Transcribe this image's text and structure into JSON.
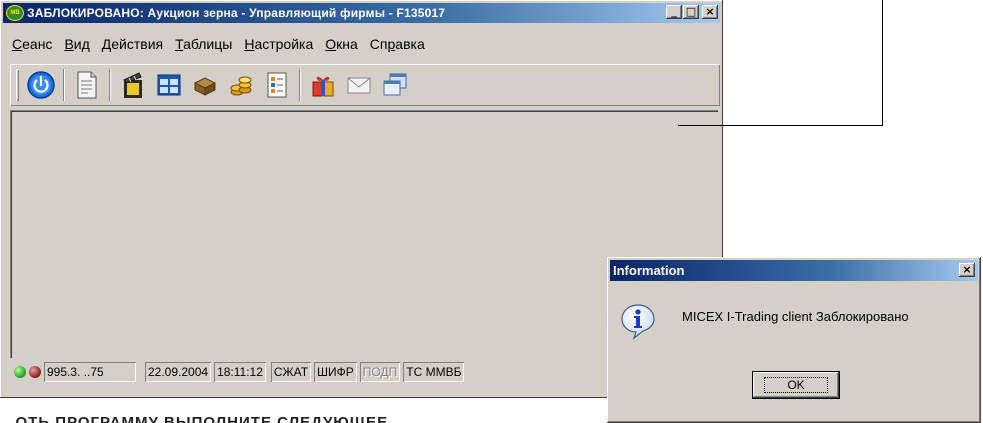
{
  "window": {
    "title": "ЗАБЛОКИРОВАНО: Аукцион зерна - Управляющий фирмы - F135017",
    "app_icon_text": "MB",
    "buttons": {
      "minimize": "_",
      "maximize": "□",
      "close": "×"
    }
  },
  "menu": [
    {
      "hot": "С",
      "rest": "еанс"
    },
    {
      "hot": "В",
      "rest": "ид"
    },
    {
      "hot": "Д",
      "rest": "ействия"
    },
    {
      "hot": "Т",
      "rest": "аблицы"
    },
    {
      "hot": "Н",
      "rest": "астройка"
    },
    {
      "hot": "О",
      "rest": "кна"
    },
    {
      "hot": "",
      "rest": "Сп",
      "hot2": "р",
      "rest2": "авка"
    }
  ],
  "toolbar": {
    "icons": [
      "power-icon",
      "document-icon",
      "clapperboard-icon",
      "table-icon",
      "box-icon",
      "coins-icon",
      "report-icon",
      "gift-icon",
      "envelope-icon",
      "window-icon"
    ]
  },
  "statusbar": {
    "address": "995.3. ..75",
    "date": "22.09.2004",
    "time": "18:11:12",
    "compress": "СЖАТ",
    "cipher": "ШИФР",
    "sign": "ПОДП",
    "exchange": "ТС ММВБ"
  },
  "dialog": {
    "title": "Information",
    "close": "×",
    "message": "MICEX I-Trading client Заблокировано",
    "ok_label": "OK"
  },
  "background_text": "...ОТЬ ПРОГРАММУ ВЫПОЛНИТЕ СЛЕДУЮЩЕЕ"
}
